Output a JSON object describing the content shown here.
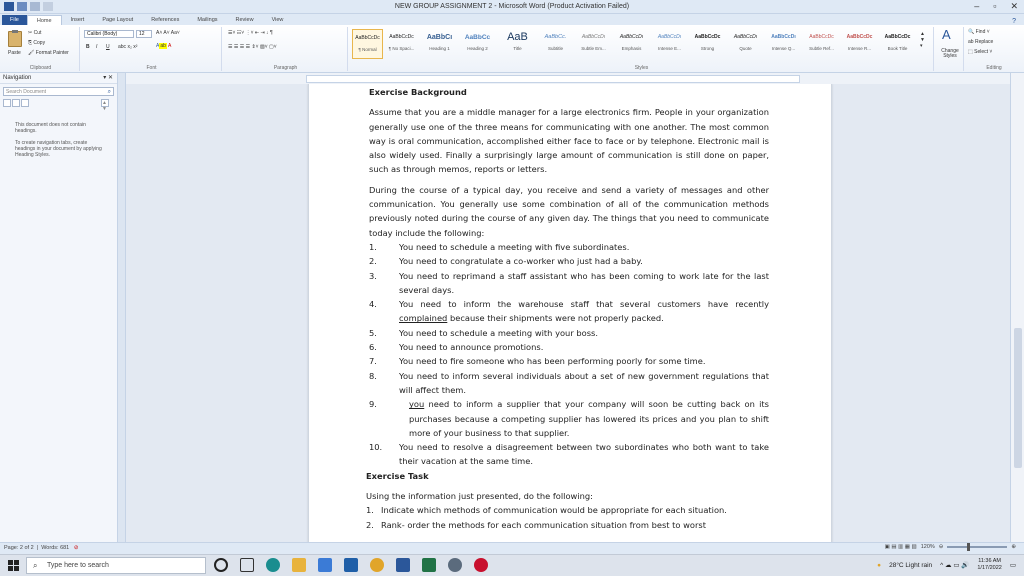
{
  "window": {
    "title": "NEW GROUP ASSIGNMENT 2 - Microsoft Word (Product Activation Failed)",
    "controls": [
      "–",
      "▫",
      "✕"
    ]
  },
  "tabs": [
    "File",
    "Home",
    "Insert",
    "Page Layout",
    "References",
    "Mailings",
    "Review",
    "View"
  ],
  "ribbon": {
    "clipboard": {
      "paste": "Paste",
      "cut": "Cut",
      "copy": "Copy",
      "format_painter": "Format Painter",
      "label": "Clipboard"
    },
    "font": {
      "name": "Calibri (Body)",
      "size": "12",
      "label": "Font",
      "bold": "B",
      "italic": "I",
      "underline": "U"
    },
    "paragraph": {
      "label": "Paragraph"
    },
    "styles": {
      "label": "Styles",
      "items": [
        {
          "sample": "AaBbCcDc",
          "name": "¶ Normal"
        },
        {
          "sample": "AaBbCcDc",
          "name": "¶ No Spaci..."
        },
        {
          "sample": "AaBbCı",
          "name": "Heading 1"
        },
        {
          "sample": "AaBbCc",
          "name": "Heading 2"
        },
        {
          "sample": "AaB",
          "name": "Title"
        },
        {
          "sample": "AaBbCc.",
          "name": "Subtitle"
        },
        {
          "sample": "AaBbCcDı",
          "name": "Subtle Em..."
        },
        {
          "sample": "AaBbCcDı",
          "name": "Emphasis"
        },
        {
          "sample": "AaBbCcDı",
          "name": "Intense E..."
        },
        {
          "sample": "AaBbCcDc",
          "name": "Strong"
        },
        {
          "sample": "AaBbCcDı",
          "name": "Quote"
        },
        {
          "sample": "AaBbCcDı",
          "name": "Intense Q..."
        },
        {
          "sample": "AaBbCcDc",
          "name": "Subtle Ref..."
        },
        {
          "sample": "AaBbCcDc",
          "name": "Intense R..."
        },
        {
          "sample": "AaBbCcDc",
          "name": "Book Title"
        }
      ],
      "change_styles": "Change Styles"
    },
    "editing": {
      "find": "Find",
      "replace": "Replace",
      "select": "Select",
      "label": "Editing"
    }
  },
  "navigation": {
    "title": "Navigation",
    "search_placeholder": "Search Document",
    "message1": "This document does not contain headings.",
    "message2": "To create navigation tabs, create headings in your document by applying Heading Styles."
  },
  "document": {
    "heading1": "Exercise Background",
    "para1": "Assume that you are a middle manager for a large electronics firm. People in your organization generally use one of the three means for communicating with one another. The most common way is oral communication, accomplished either face to face or by telephone. Electronic mail is also widely used. Finally a surprisingly large amount of communication is still done on paper, such as through memos, reports or letters.",
    "para2": "During the course of a typical day, you receive and send a variety of messages and other communication. You generally use some combination of all of the communication methods previously noted during the course of any given day. The things that you need to communicate today include the following:",
    "list": [
      {
        "num": "1.",
        "text": "You need to schedule a meeting with five subordinates."
      },
      {
        "num": "2.",
        "text": "You need to congratulate a co-worker who just had a baby."
      },
      {
        "num": "3.",
        "text": "You need to reprimand a staff assistant who has been coming to work late for the last several days."
      },
      {
        "num": "4.",
        "pre": "You need to inform the warehouse staff that several customers have recently ",
        "u": "complained",
        "post": " because their shipments were not properly packed."
      },
      {
        "num": "5.",
        "text": "You need to schedule a meeting with your boss."
      },
      {
        "num": "6.",
        "text": "You need to announce promotions."
      },
      {
        "num": "7.",
        "text": "You need to fire someone who has been performing poorly for some time."
      },
      {
        "num": "8.",
        "text": "You need to inform several individuals about a set of new government regulations that will affect them."
      },
      {
        "num": "9.",
        "pre": "",
        "u": "you",
        "post": " need to inform a supplier that your company will soon be cutting back on its purchases because a competing supplier has lowered its prices and you plan to shift more of your business to that supplier."
      },
      {
        "num": "10.",
        "text": "You need to resolve a disagreement between two subordinates who both want to take their vacation at the same time."
      }
    ],
    "heading2": "Exercise Task",
    "task_intro": "Using the information just presented, do the following:",
    "tasks": [
      {
        "num": "1.",
        "text": "Indicate which methods of communication would be appropriate for each situation."
      },
      {
        "num": "2.",
        "text": "Rank- order the methods for each communication situation from best to worst"
      }
    ]
  },
  "status": {
    "page": "Page: 2 of 2",
    "words": "Words: 681",
    "zoom": "120%"
  },
  "taskbar": {
    "search_placeholder": "Type here to search",
    "weather": "28°C  Light rain",
    "time": "11:36 AM",
    "date": "1/17/2022"
  },
  "colors": {
    "accent": "#2b579a",
    "word_icon": "#2b579a",
    "excel_icon": "#217346"
  }
}
